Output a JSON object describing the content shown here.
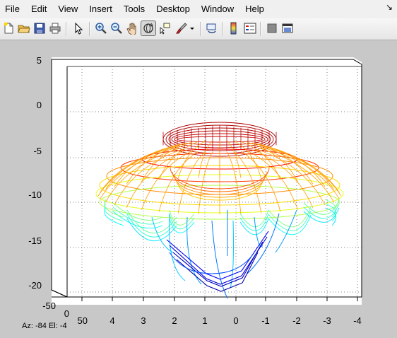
{
  "menu": [
    "File",
    "Edit",
    "View",
    "Insert",
    "Tools",
    "Desktop",
    "Window",
    "Help"
  ],
  "menu_arrow": "↘",
  "toolbar": [
    {
      "name": "new-figure-icon"
    },
    {
      "name": "open-file-icon"
    },
    {
      "name": "save-icon"
    },
    {
      "name": "print-icon"
    },
    {
      "name": "edit-plot-arrow-icon"
    },
    {
      "name": "zoom-in-icon"
    },
    {
      "name": "zoom-out-icon"
    },
    {
      "name": "pan-hand-icon"
    },
    {
      "name": "rotate-3d-icon",
      "active": true
    },
    {
      "name": "data-cursor-icon"
    },
    {
      "name": "brush-icon"
    },
    {
      "name": "link-plot-icon"
    },
    {
      "name": "colorbar-icon"
    },
    {
      "name": "legend-icon"
    },
    {
      "name": "hide-plot-tools-icon"
    },
    {
      "name": "show-plot-tools-icon"
    }
  ],
  "axes": {
    "z_ticks": [
      "5",
      "0",
      "-5",
      "-10",
      "-15",
      "-20"
    ],
    "x_ticks": [
      "4",
      "3",
      "2",
      "1",
      "0",
      "-1",
      "-2",
      "-3",
      "-4"
    ],
    "y_ticks": [
      "-50",
      "0",
      "50"
    ]
  },
  "status": {
    "az_label": "Az:",
    "az_value": "-84",
    "el_label": "El:",
    "el_value": "-4"
  },
  "colors": {
    "figure_bg": "#c8c8c8",
    "axes_bg": "#ffffff",
    "colormap": "jet"
  }
}
